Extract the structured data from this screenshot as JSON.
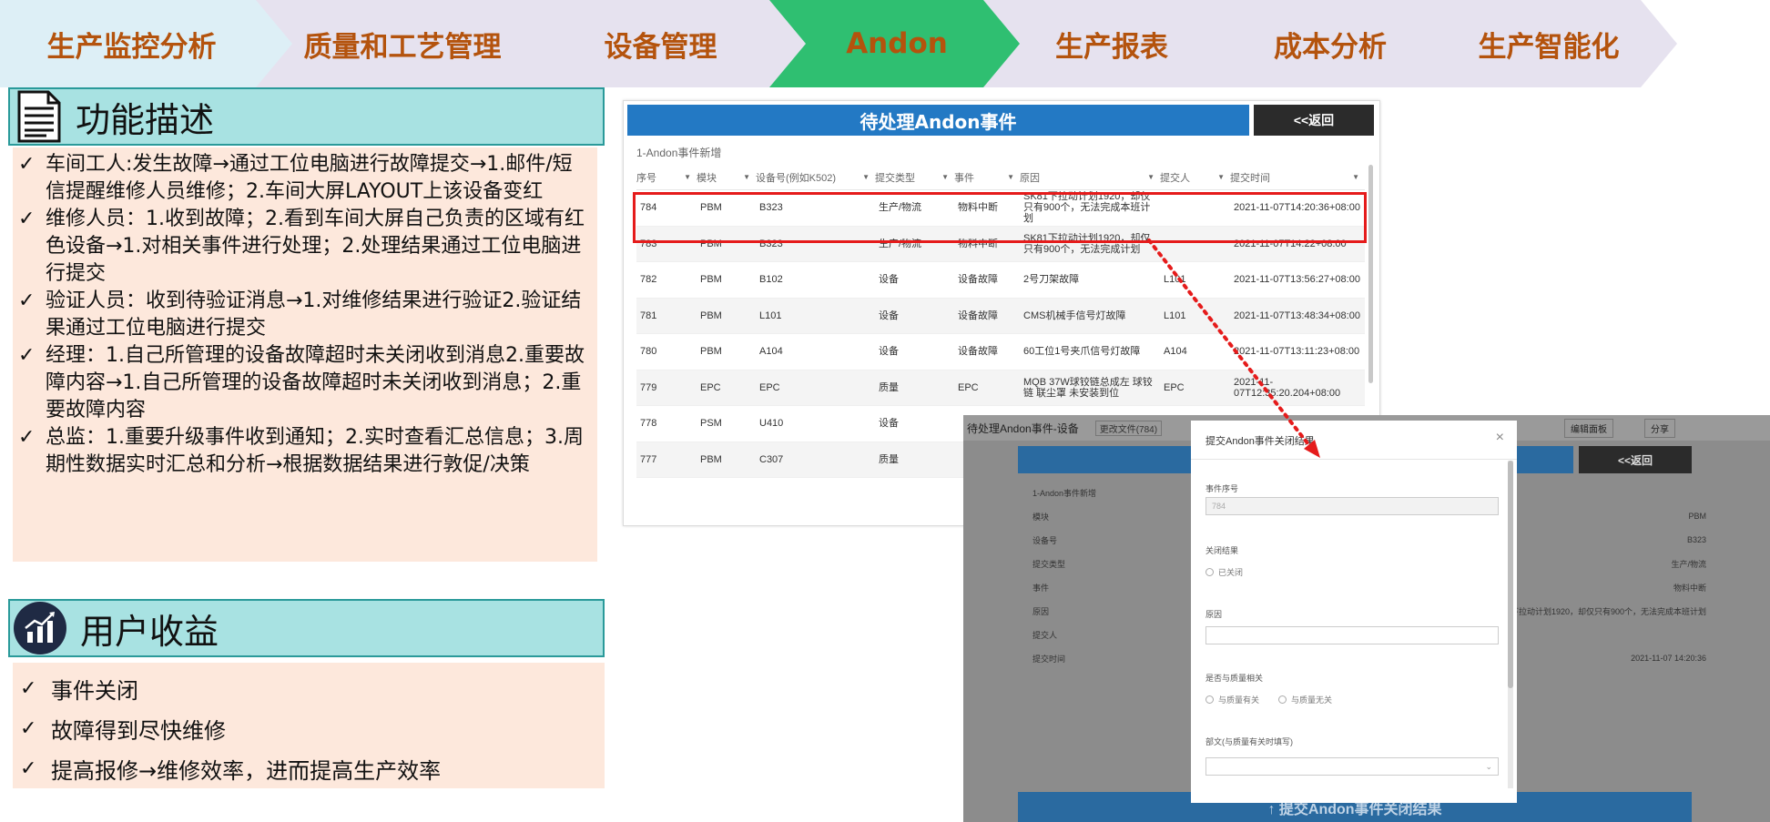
{
  "nav": {
    "tabs": [
      {
        "label": "生产监控分析",
        "color": "#ddeff6"
      },
      {
        "label": "质量和工艺管理",
        "color": "#e6e2ef"
      },
      {
        "label": "设备管理",
        "color": "#e6e2ef"
      },
      {
        "label": "Andon",
        "color": "#2fbf71",
        "active": true
      },
      {
        "label": "生产报表",
        "color": "#e6e2ef"
      },
      {
        "label": "成本分析",
        "color": "#e6e2ef"
      },
      {
        "label": "生产智能化",
        "color": "#e6e2ef"
      }
    ]
  },
  "func": {
    "title": "功能描述",
    "items": [
      "车间工人:发生故障→通过工位电脑进行故障提交→1.邮件/短信提醒维修人员维修；2.车间大屏LAYOUT上该设备变红",
      "维修人员：1.收到故障；2.看到车间大屏自己负责的区域有红色设备→1.对相关事件进行处理；2.处理结果通过工位电脑进行提交",
      "验证人员：收到待验证消息→1.对维修结果进行验证2.验证结果通过工位电脑进行提交",
      "经理：1.自己所管理的设备故障超时未关闭收到消息2.重要故障内容→1.自己所管理的设备故障超时未关闭收到消息；2.重要故障内容",
      "总监：1.重要升级事件收到通知；2.实时查看汇总信息；3.周期性数据实时汇总和分析→根据数据结果进行敦促/决策"
    ]
  },
  "benefit": {
    "title": "用户收益",
    "items": [
      "事件关闭",
      "故障得到尽快维修",
      "提高报修→维修效率，进而提高生产效率"
    ]
  },
  "tick": "✓",
  "pending": {
    "title": "待处理Andon事件",
    "back_label": "<<返回",
    "subtitle": "1-Andon事件新增",
    "columns": [
      "序号",
      "模块",
      "设备号(例如K502)",
      "提交类型",
      "事件",
      "原因",
      "提交人",
      "提交时间"
    ],
    "rows": [
      [
        "784",
        "PBM",
        "B323",
        "生产/物流",
        "物料中断",
        "SK81下拉动计划1920，却仅只有900个，无法完成本班计划",
        "",
        "2021-11-07T14:20:36+08:00"
      ],
      [
        "783",
        "PBM",
        "B323",
        "生产/物流",
        "物料中断",
        "SK81下拉动计划1920，却仅只有900个，无法完成计划",
        "",
        "2021-11-07T14:22+08:00"
      ],
      [
        "782",
        "PBM",
        "B102",
        "设备",
        "设备故障",
        "2号刀架故障",
        "L101",
        "2021-11-07T13:56:27+08:00"
      ],
      [
        "781",
        "PBM",
        "L101",
        "设备",
        "设备故障",
        "CMS机械手信号灯故障",
        "L101",
        "2021-11-07T13:48:34+08:00"
      ],
      [
        "780",
        "PBM",
        "A104",
        "设备",
        "设备故障",
        "60工位1号夹爪信号灯故障",
        "A104",
        "2021-11-07T13:11:23+08:00"
      ],
      [
        "779",
        "EPC",
        "EPC",
        "质量",
        "EPC",
        "MQB 37W球铰链总成左 球铰链 联尘罩 未安装到位",
        "EPC",
        "2021-11-07T12:35:20.204+08:00"
      ],
      [
        "778",
        "PSM",
        "U410",
        "设备",
        "",
        "",
        "",
        ""
      ],
      [
        "777",
        "PBM",
        "C307",
        "质量",
        "",
        "",
        "",
        ""
      ]
    ]
  },
  "dialog_page": {
    "top_title": "待处理Andon事件-设备",
    "top_tag": "更改文件(784)",
    "btn_edit": "编辑面板",
    "btn_share": "分享",
    "back_label": "<<返回",
    "bg_subtitle": "1-Andon事件新增",
    "bg_fields": [
      [
        "模块",
        "PBM"
      ],
      [
        "设备号",
        "B323"
      ],
      [
        "提交类型",
        "生产/物流"
      ],
      [
        "事件",
        "物料中断"
      ],
      [
        "原因",
        "SK81下拉动计划1920，却仅只有900个，无法完成本班计划"
      ],
      [
        "提交人",
        ""
      ],
      [
        "提交时间",
        "2021-11-07 14:20:36"
      ]
    ],
    "submit_label": "↑ 提交Andon事件关闭结果",
    "dialog": {
      "title": "提交Andon事件关闭结果",
      "close": "×",
      "f1_label": "事件序号",
      "f1_value": "784",
      "f2_label": "关闭结果",
      "f2_opt": "已关闭",
      "f3_label": "原因",
      "f4_label": "是否与质量相关",
      "f4_opt1": "与质量有关",
      "f4_opt2": "与质量无关",
      "f5_label": "部文(与质量有关时填写)"
    }
  }
}
